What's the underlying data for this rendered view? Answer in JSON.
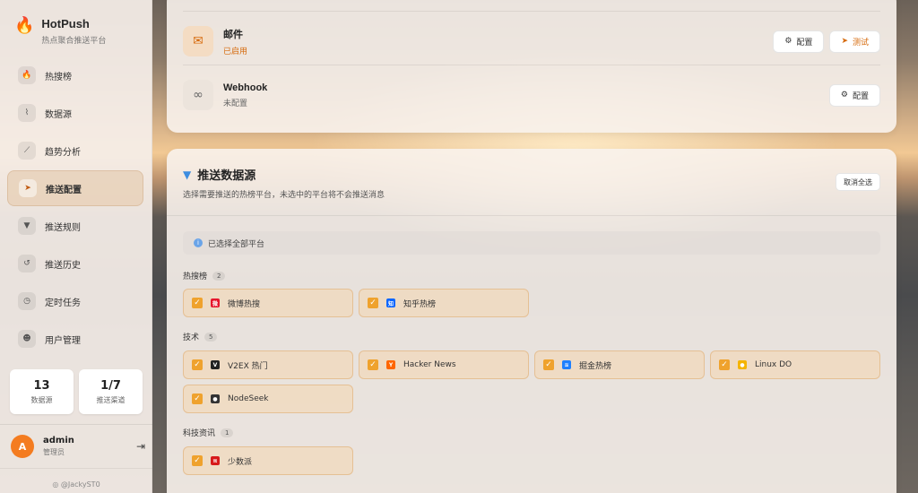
{
  "app": {
    "name": "HotPush",
    "subtitle": "热点聚合推送平台"
  },
  "sidebar": {
    "items": [
      {
        "label": "热搜榜",
        "icon": "flame-icon",
        "glyph": "🔥"
      },
      {
        "label": "数据源",
        "icon": "rss-icon",
        "glyph": "⌇"
      },
      {
        "label": "趋势分析",
        "icon": "trend-icon",
        "glyph": "⟋"
      },
      {
        "label": "推送配置",
        "icon": "send-icon",
        "glyph": "➤"
      },
      {
        "label": "推送规则",
        "icon": "filter-icon",
        "glyph": "▼"
      },
      {
        "label": "推送历史",
        "icon": "history-icon",
        "glyph": "↺"
      },
      {
        "label": "定时任务",
        "icon": "clock-icon",
        "glyph": "◷"
      },
      {
        "label": "用户管理",
        "icon": "users-icon",
        "glyph": "☻"
      }
    ],
    "active_index": 3
  },
  "stats": [
    {
      "value": "13",
      "label": "数据源"
    },
    {
      "value": "1/7",
      "label": "推送渠道"
    }
  ],
  "user": {
    "initial": "A",
    "name": "admin",
    "role": "管理员"
  },
  "footer": {
    "github": "@JackyST0"
  },
  "channels": [
    {
      "name": "邮件",
      "status": "已启用",
      "icon": "mail-icon",
      "status_color": "#d66a0c",
      "config_label": "配置",
      "test_label": "测试"
    },
    {
      "name": "Webhook",
      "status": "未配置",
      "icon": "link-icon",
      "status_color": "#666666",
      "config_label": "配置"
    }
  ],
  "sources": {
    "title": "推送数据源",
    "description": "选择需要推送的热榜平台，未选中的平台将不会推送消息",
    "deselect_label": "取消全选",
    "info": "已选择全部平台",
    "groups": [
      {
        "label": "热搜榜",
        "count": "2",
        "items": [
          {
            "name": "微博热搜",
            "icon": "weibo-icon",
            "color": "#e6162d",
            "glyph": "微"
          },
          {
            "name": "知乎热榜",
            "icon": "zhihu-icon",
            "color": "#0a66ff",
            "glyph": "知"
          }
        ]
      },
      {
        "label": "技术",
        "count": "5",
        "items": [
          {
            "name": "V2EX 热门",
            "icon": "v2ex-icon",
            "color": "#222222",
            "glyph": "V"
          },
          {
            "name": "Hacker News",
            "icon": "hackernews-icon",
            "color": "#ff6600",
            "glyph": "Y"
          },
          {
            "name": "掘金热榜",
            "icon": "juejin-icon",
            "color": "#1e80ff",
            "glyph": "≋"
          },
          {
            "name": "Linux DO",
            "icon": "linuxdo-icon",
            "color": "#f5b400",
            "glyph": "●"
          },
          {
            "name": "NodeSeek",
            "icon": "nodeseek-icon",
            "color": "#333333",
            "glyph": "●"
          }
        ]
      },
      {
        "label": "科技资讯",
        "count": "1",
        "items": [
          {
            "name": "少数派",
            "icon": "sspai-icon",
            "color": "#d71a1b",
            "glyph": "π"
          }
        ]
      }
    ]
  }
}
